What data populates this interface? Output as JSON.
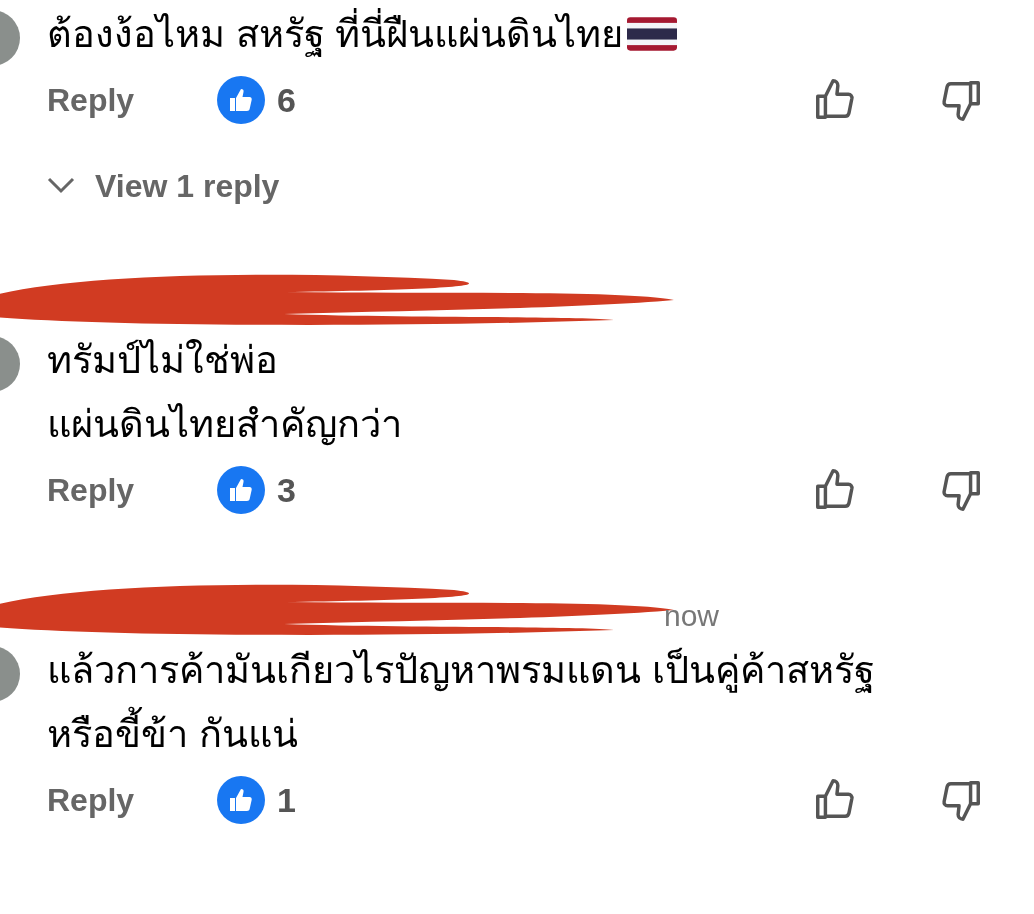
{
  "comments": [
    {
      "redacted_name": false,
      "lines": [
        "ต้องง้อไหม สหรัฐ ที่นี่ฝืนแผ่นดินไทย"
      ],
      "flag_emoji": true,
      "reply_label": "Reply",
      "like_count": "6",
      "view_replies": "View 1 reply"
    },
    {
      "redacted_name": true,
      "lines": [
        "ทรัมป์ไม่ใช่พ่อ",
        "แผ่นดินไทยสำคัญกว่า"
      ],
      "reply_label": "Reply",
      "like_count": "3"
    },
    {
      "redacted_name": true,
      "timestamp": "now",
      "lines": [
        "แล้วการค้ามันเกียวไรปัญหาพรมแดน เป็นคู่ค้าสหรัฐ",
        "หรือขี้ข้า กันแน่"
      ],
      "reply_label": "Reply",
      "like_count": "1"
    }
  ]
}
